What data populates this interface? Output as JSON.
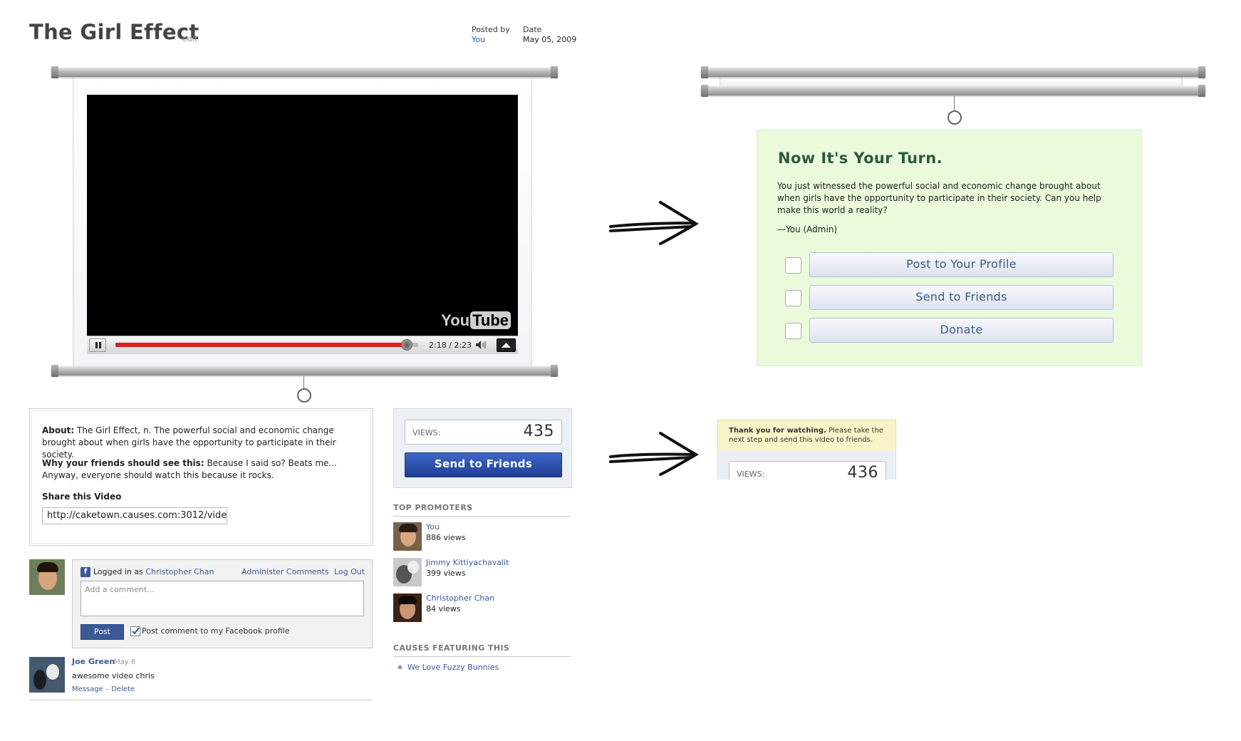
{
  "header": {
    "title": "The Girl Effect",
    "edit_label": "edit",
    "posted_by_label": "Posted by",
    "posted_by_value": "You",
    "date_label": "Date",
    "date_value": "May 05, 2009"
  },
  "video": {
    "time": "2:18 / 2:23",
    "progress": 0.965,
    "logo_you": "You",
    "logo_tube": "Tube"
  },
  "about": {
    "about_label": "About:",
    "about_text": "The Girl Effect, n. The powerful social and economic change brought about when girls have the opportunity to participate in their society.",
    "why_label": "Why your friends should see this:",
    "why_text": "Because I said so? Beats me... Anyway, everyone should watch this because it rocks.",
    "share_label": "Share this Video",
    "share_url": "http://caketown.causes.com:3012/vide"
  },
  "views": {
    "label": "VIEWS:",
    "count": "435",
    "send_button": "Send to Friends"
  },
  "promoters": {
    "heading": "TOP PROMOTERS",
    "items": [
      {
        "name": "You",
        "views": "886 views"
      },
      {
        "name": "Jimmy Kittiyachavalit",
        "views": "399 views"
      },
      {
        "name": "Christopher Chan",
        "views": "84 views"
      }
    ]
  },
  "causes": {
    "heading": "CAUSES FEATURING THIS",
    "items": [
      "We Love Fuzzy Bunnies"
    ]
  },
  "comments": {
    "logged_in_prefix": "Logged in as",
    "logged_in_user": "Christopher Chan",
    "administer": "Administer Comments",
    "logout": "Log Out",
    "placeholder": "Add a comment...",
    "post_button": "Post",
    "post_to_profile": "Post comment to my Facebook profile",
    "items": [
      {
        "author": "Joe Green",
        "date": "May 6",
        "text": "awesome video chris",
        "action_message": "Message",
        "action_sep": " – ",
        "action_delete": "Delete"
      }
    ]
  },
  "turn_panel": {
    "title": "Now It's Your Turn.",
    "body": "You just witnessed the powerful social and economic change brought about when girls have the opportunity to participate in their society. Can you help make this world a reality?",
    "signature": "—You (Admin)",
    "buttons": [
      "Post to Your Profile",
      "Send to Friends",
      "Donate"
    ]
  },
  "thanks": {
    "bold": "Thank you for watching.",
    "text": "Please take the next step and send this video to friends.",
    "views_label": "VIEWS:",
    "views_count": "436"
  },
  "colors": {
    "link": "#3b5998",
    "panel_green": "#eafadb",
    "progress_red": "#e01e1e",
    "send_blue": "#2a4da8"
  }
}
